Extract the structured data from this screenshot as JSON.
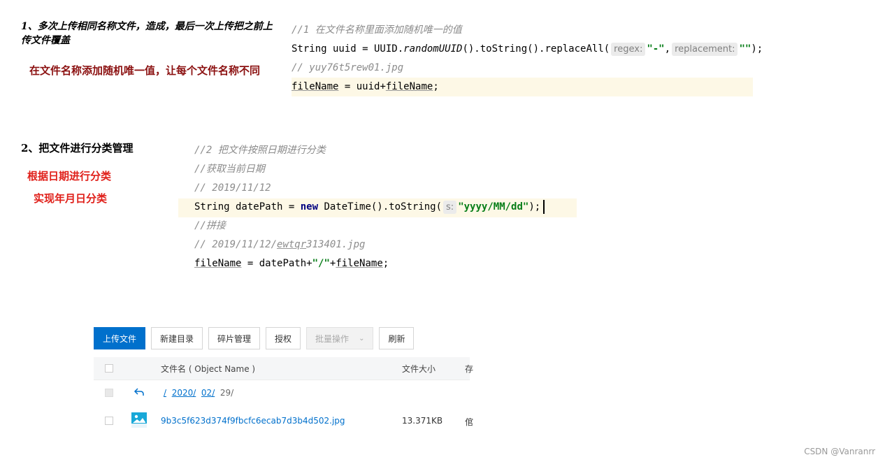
{
  "section1": {
    "heading": "1、多次上传相同名称文件，造成，最后一次上传把之前上传文件覆盖",
    "note": "在文件名称添加随机唯一值，让每个文件名称不同",
    "code": {
      "comment1": "//1 在文件名称里面添加随机唯一的值",
      "line2_prefix": "String uuid = UUID.",
      "line2_method": "randomUUID",
      "line2_mid": "().toString().replaceAll(",
      "hint_regex": "regex:",
      "str_dash": "\"-\"",
      "comma": ",",
      "hint_replacement": "replacement:",
      "str_empty": "\"\"",
      "line2_end": ");",
      "comment2": "// yuy76t5rew01.jpg",
      "line4_field1": "fileName",
      "line4_mid": " = uuid+",
      "line4_field2": "fileName",
      "line4_end": ";"
    }
  },
  "section2": {
    "heading": "2、把文件进行分类管理",
    "note1": "根据日期进行分类",
    "note2": "实现年月日分类",
    "code": {
      "comment1": "//2 把文件按照日期进行分类",
      "comment2": "//获取当前日期",
      "comment3": "//   2019/11/12",
      "line4_prefix": "String datePath = ",
      "kw_new": "new",
      "line4_mid": " DateTime().toString(",
      "hint_s": "s:",
      "str_fmt": "\"yyyy/MM/dd\"",
      "line4_end": ");",
      "comment4": "//拼接",
      "comment5_prefix": "//  2019/11/12/",
      "comment5_u": "ewtqr",
      "comment5_end": "313401.jpg",
      "line7_field1": "fileName",
      "line7_mid": " = datePath+",
      "str_slash": "\"/\"",
      "plus": "+",
      "line7_field2": "fileName",
      "line7_end": ";"
    }
  },
  "oss": {
    "buttons": {
      "upload": "上传文件",
      "new_dir": "新建目录",
      "fragments": "碎片管理",
      "auth": "授权",
      "batch": "批量操作",
      "refresh": "刷新"
    },
    "table": {
      "col_name": "文件名 ( Object Name )",
      "col_size": "文件大小",
      "col_cut": "存"
    },
    "path": {
      "root": "/",
      "year": "2020/",
      "month": "02/",
      "day": "29/"
    },
    "file": {
      "name": "9b3c5f623d374f9fbcfc6ecab7d3b4d502.jpg",
      "size": "13.371KB",
      "extra": "倌"
    }
  },
  "watermark": "CSDN @Vanranrr",
  "colors": {
    "primary": "#0070cc",
    "note_dark_red": "#8b1010",
    "note_red": "#e0201a",
    "code_string": "#067d17",
    "code_keyword": "#000080",
    "code_comment": "#8c8c8c",
    "highlight_line": "#fdf8e6"
  }
}
